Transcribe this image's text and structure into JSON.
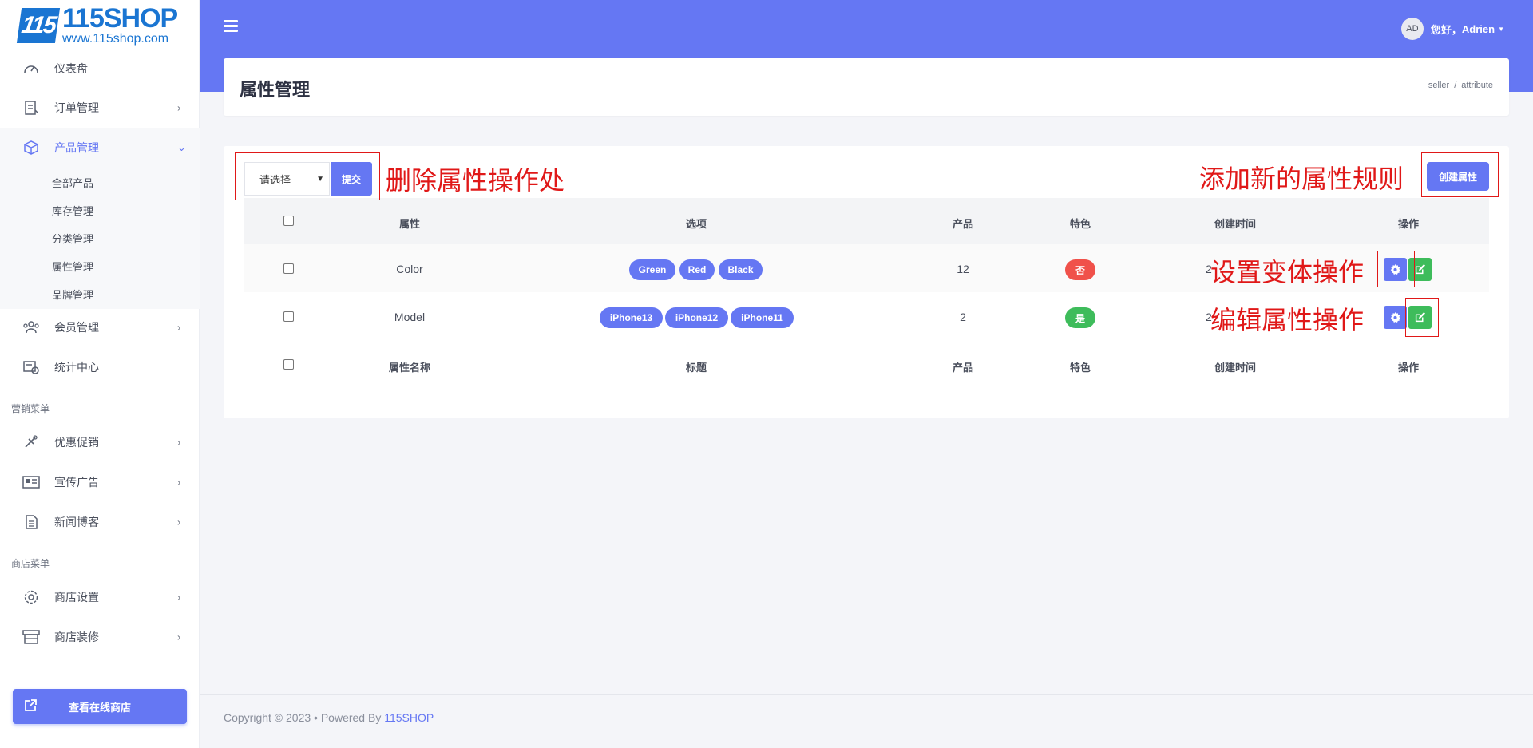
{
  "logo": {
    "mark": "115",
    "name": "115SHOP",
    "url": "www.115shop.com"
  },
  "sidebar": {
    "items": [
      {
        "label": "仪表盘"
      },
      {
        "label": "订单管理"
      },
      {
        "label": "产品管理"
      },
      {
        "label": "会员管理"
      },
      {
        "label": "统计中心"
      },
      {
        "label": "优惠促销"
      },
      {
        "label": "宣传广告"
      },
      {
        "label": "新闻博客"
      },
      {
        "label": "商店设置"
      },
      {
        "label": "商店装修"
      }
    ],
    "sub_items": [
      "全部产品",
      "库存管理",
      "分类管理",
      "属性管理",
      "品牌管理"
    ],
    "section_marketing": "营销菜单",
    "section_shop": "商店菜单",
    "shop_button": "查看在线商店"
  },
  "header": {
    "user_initials": "AD",
    "greeting": "您好，",
    "username": "Adrien"
  },
  "page": {
    "title": "属性管理",
    "breadcrumb": [
      "seller",
      "attribute"
    ]
  },
  "toolbar": {
    "select_value": "请选择",
    "submit_label": "提交",
    "create_label": "创建属性"
  },
  "table": {
    "headers": [
      "属性",
      "选项",
      "产品",
      "特色",
      "创建时间",
      "操作"
    ],
    "rows": [
      {
        "name": "Color",
        "options": [
          "Green",
          "Red",
          "Black"
        ],
        "products": "12",
        "featured": "否",
        "time_visible": "2"
      },
      {
        "name": "Model",
        "options": [
          "iPhone13",
          "iPhone12",
          "iPhone11"
        ],
        "products": "2",
        "featured": "是",
        "time_visible": "2"
      }
    ],
    "footer_headers": [
      "属性名称",
      "标题",
      "产品",
      "特色",
      "创建时间",
      "操作"
    ]
  },
  "annotations": {
    "delete": "删除属性操作处",
    "add": "添加新的属性规则",
    "variant": "设置变体操作",
    "edit": "编辑属性操作"
  },
  "footer": {
    "copyright": "Copyright © 2023  •  Powered By ",
    "brand": "115SHOP"
  },
  "colors": {
    "primary": "#6577f3",
    "danger": "#f0514a",
    "success": "#3ebc5b",
    "annotation": "#e01818"
  },
  "icons": [
    "dashboard-icon",
    "order-icon",
    "product-icon",
    "member-icon",
    "stats-icon",
    "promotion-icon",
    "ad-icon",
    "news-icon",
    "settings-icon",
    "decor-icon",
    "external-link-icon",
    "gear-icon",
    "edit-icon",
    "menu-icon"
  ]
}
